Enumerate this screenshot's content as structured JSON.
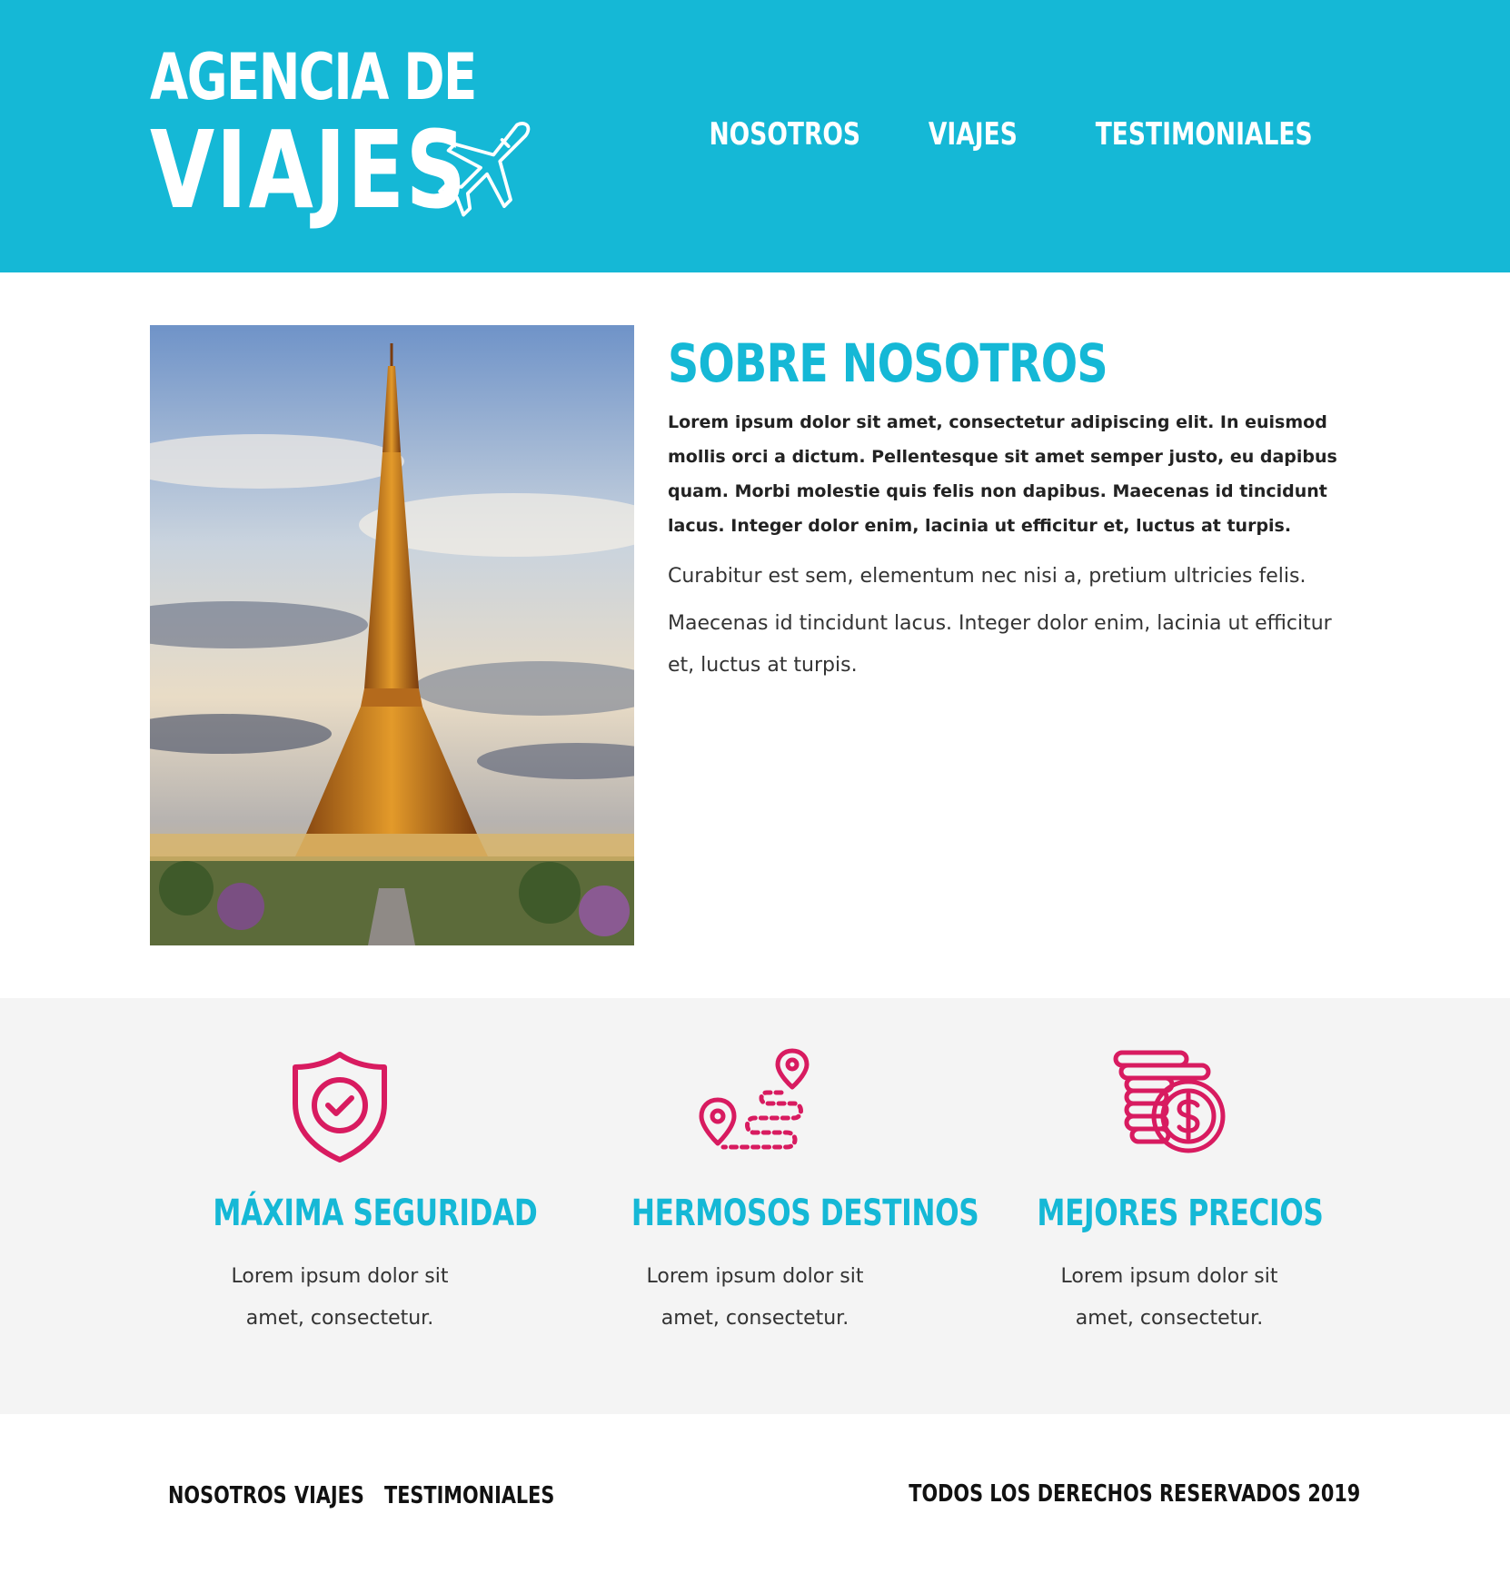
{
  "header": {
    "logo_line1": "AGENCIA DE",
    "logo_line2": "VIAJES",
    "nav": [
      "NOSOTROS",
      "VIAJES",
      "TESTIMONIALES"
    ]
  },
  "about": {
    "title": "SOBRE NOSOTROS",
    "lead": "Lorem ipsum dolor sit amet, consectetur adipiscing elit. In euismod mollis orci a dictum. Pellentesque sit amet semper justo, eu dapibus quam. Morbi molestie quis felis non dapibus. Maecenas id tincidunt lacus. Integer dolor enim, lacinia ut efficitur et, luctus at turpis.",
    "p1": "Curabitur est sem, elementum nec nisi a, pretium ultricies felis.",
    "p2": "Maecenas id tincidunt lacus. Integer dolor enim, lacinia ut efficitur et, luctus at turpis."
  },
  "features": [
    {
      "icon": "shield-check-icon",
      "title": "MÁXIMA SEGURIDAD",
      "text": "Lorem ipsum dolor sit amet, consectetur."
    },
    {
      "icon": "map-route-icon",
      "title": "HERMOSOS DESTINOS",
      "text": "Lorem ipsum dolor sit amet, consectetur."
    },
    {
      "icon": "coins-dollar-icon",
      "title": "MEJORES PRECIOS",
      "text": "Lorem ipsum dolor sit amet, consectetur."
    }
  ],
  "footer": {
    "nav": [
      "NOSOTROS",
      "VIAJES",
      "TESTIMONIALES"
    ],
    "copyright": "TODOS LOS DERECHOS RESERVADOS 2019"
  },
  "colors": {
    "brand": "#15b8d6",
    "accent": "#d81b60",
    "features_bg": "#f4f4f4"
  }
}
